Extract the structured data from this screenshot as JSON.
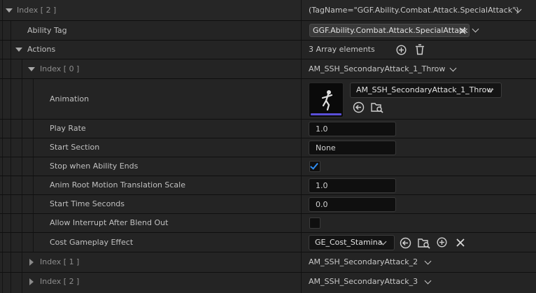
{
  "index2_header": {
    "label": "Index [ 2 ]",
    "value": "(TagName=\"GGF.Ability.Combat.Attack.SpecialAttack\")"
  },
  "ability_tag": {
    "label": "Ability Tag",
    "tag": "GGF.Ability.Combat.Attack.SpecialAttack"
  },
  "actions": {
    "label": "Actions",
    "value": "3 Array elements"
  },
  "item0": {
    "label": "Index [ 0 ]",
    "value": "AM_SSH_SecondaryAttack_1_Throw"
  },
  "animation": {
    "label": "Animation",
    "asset": "AM_SSH_SecondaryAttack_1_Throw"
  },
  "play_rate": {
    "label": "Play Rate",
    "value": "1.0"
  },
  "start_section": {
    "label": "Start Section",
    "value": "None"
  },
  "stop_when_ends": {
    "label": "Stop when Ability Ends",
    "checked": true
  },
  "root_motion": {
    "label": "Anim Root Motion Translation Scale",
    "value": "1.0"
  },
  "start_time": {
    "label": "Start Time Seconds",
    "value": "0.0"
  },
  "allow_interrupt": {
    "label": "Allow Interrupt After Blend Out",
    "checked": false
  },
  "cost_effect": {
    "label": "Cost Gameplay Effect",
    "value": "GE_Cost_Stamina"
  },
  "item1": {
    "label": "Index [ 1 ]",
    "value": "AM_SSH_SecondaryAttack_2"
  },
  "item2": {
    "label": "Index [ 2 ]",
    "value": "AM_SSH_SecondaryAttack_3"
  },
  "colors": {
    "accent": "#2e8cf0",
    "thumb_bar": "#5a4fd8",
    "background": "#242424"
  }
}
